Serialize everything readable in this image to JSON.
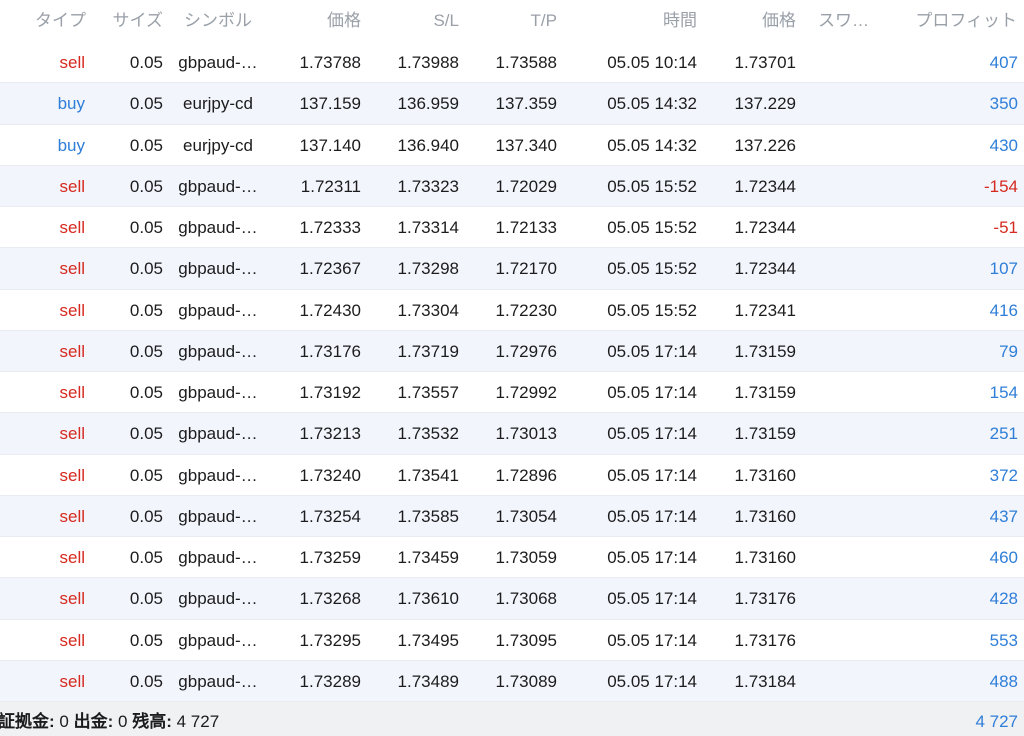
{
  "header": {
    "type": "タイプ",
    "size": "サイズ",
    "symbol": "シンボル",
    "open_price": "価格",
    "sl": "S/L",
    "tp": "T/P",
    "time": "時間",
    "price": "価格",
    "swap": "スワ…",
    "profit": "プロフィット"
  },
  "colors": {
    "sell": "#d62a20",
    "buy": "#2f7ed8",
    "profit_positive": "#2f7ed8",
    "profit_negative": "#d62a20",
    "alt_row": "#f2f5fb"
  },
  "rows": [
    {
      "type": "sell",
      "size": "0.05",
      "symbol": "gbpaud-…",
      "open_price": "1.73788",
      "sl": "1.73988",
      "tp": "1.73588",
      "time": "05.05 10:14",
      "price": "1.73701",
      "swap": "",
      "profit": "407"
    },
    {
      "type": "buy",
      "size": "0.05",
      "symbol": "eurjpy-cd",
      "open_price": "137.159",
      "sl": "136.959",
      "tp": "137.359",
      "time": "05.05 14:32",
      "price": "137.229",
      "swap": "",
      "profit": "350"
    },
    {
      "type": "buy",
      "size": "0.05",
      "symbol": "eurjpy-cd",
      "open_price": "137.140",
      "sl": "136.940",
      "tp": "137.340",
      "time": "05.05 14:32",
      "price": "137.226",
      "swap": "",
      "profit": "430"
    },
    {
      "type": "sell",
      "size": "0.05",
      "symbol": "gbpaud-…",
      "open_price": "1.72311",
      "sl": "1.73323",
      "tp": "1.72029",
      "time": "05.05 15:52",
      "price": "1.72344",
      "swap": "",
      "profit": "-154"
    },
    {
      "type": "sell",
      "size": "0.05",
      "symbol": "gbpaud-…",
      "open_price": "1.72333",
      "sl": "1.73314",
      "tp": "1.72133",
      "time": "05.05 15:52",
      "price": "1.72344",
      "swap": "",
      "profit": "-51"
    },
    {
      "type": "sell",
      "size": "0.05",
      "symbol": "gbpaud-…",
      "open_price": "1.72367",
      "sl": "1.73298",
      "tp": "1.72170",
      "time": "05.05 15:52",
      "price": "1.72344",
      "swap": "",
      "profit": "107"
    },
    {
      "type": "sell",
      "size": "0.05",
      "symbol": "gbpaud-…",
      "open_price": "1.72430",
      "sl": "1.73304",
      "tp": "1.72230",
      "time": "05.05 15:52",
      "price": "1.72341",
      "swap": "",
      "profit": "416"
    },
    {
      "type": "sell",
      "size": "0.05",
      "symbol": "gbpaud-…",
      "open_price": "1.73176",
      "sl": "1.73719",
      "tp": "1.72976",
      "time": "05.05 17:14",
      "price": "1.73159",
      "swap": "",
      "profit": "79"
    },
    {
      "type": "sell",
      "size": "0.05",
      "symbol": "gbpaud-…",
      "open_price": "1.73192",
      "sl": "1.73557",
      "tp": "1.72992",
      "time": "05.05 17:14",
      "price": "1.73159",
      "swap": "",
      "profit": "154"
    },
    {
      "type": "sell",
      "size": "0.05",
      "symbol": "gbpaud-…",
      "open_price": "1.73213",
      "sl": "1.73532",
      "tp": "1.73013",
      "time": "05.05 17:14",
      "price": "1.73159",
      "swap": "",
      "profit": "251"
    },
    {
      "type": "sell",
      "size": "0.05",
      "symbol": "gbpaud-…",
      "open_price": "1.73240",
      "sl": "1.73541",
      "tp": "1.72896",
      "time": "05.05 17:14",
      "price": "1.73160",
      "swap": "",
      "profit": "372"
    },
    {
      "type": "sell",
      "size": "0.05",
      "symbol": "gbpaud-…",
      "open_price": "1.73254",
      "sl": "1.73585",
      "tp": "1.73054",
      "time": "05.05 17:14",
      "price": "1.73160",
      "swap": "",
      "profit": "437"
    },
    {
      "type": "sell",
      "size": "0.05",
      "symbol": "gbpaud-…",
      "open_price": "1.73259",
      "sl": "1.73459",
      "tp": "1.73059",
      "time": "05.05 17:14",
      "price": "1.73160",
      "swap": "",
      "profit": "460"
    },
    {
      "type": "sell",
      "size": "0.05",
      "symbol": "gbpaud-…",
      "open_price": "1.73268",
      "sl": "1.73610",
      "tp": "1.73068",
      "time": "05.05 17:14",
      "price": "1.73176",
      "swap": "",
      "profit": "428"
    },
    {
      "type": "sell",
      "size": "0.05",
      "symbol": "gbpaud-…",
      "open_price": "1.73295",
      "sl": "1.73495",
      "tp": "1.73095",
      "time": "05.05 17:14",
      "price": "1.73176",
      "swap": "",
      "profit": "553"
    },
    {
      "type": "sell",
      "size": "0.05",
      "symbol": "gbpaud-…",
      "open_price": "1.73289",
      "sl": "1.73489",
      "tp": "1.73089",
      "time": "05.05 17:14",
      "price": "1.73184",
      "swap": "",
      "profit": "488"
    }
  ],
  "footer": {
    "margin_label": "証拠金:",
    "margin_value": "0",
    "withdraw_label": "出金:",
    "withdraw_value": "0",
    "balance_label": "残高:",
    "balance_value": "4 727",
    "total_profit": "4 727"
  }
}
